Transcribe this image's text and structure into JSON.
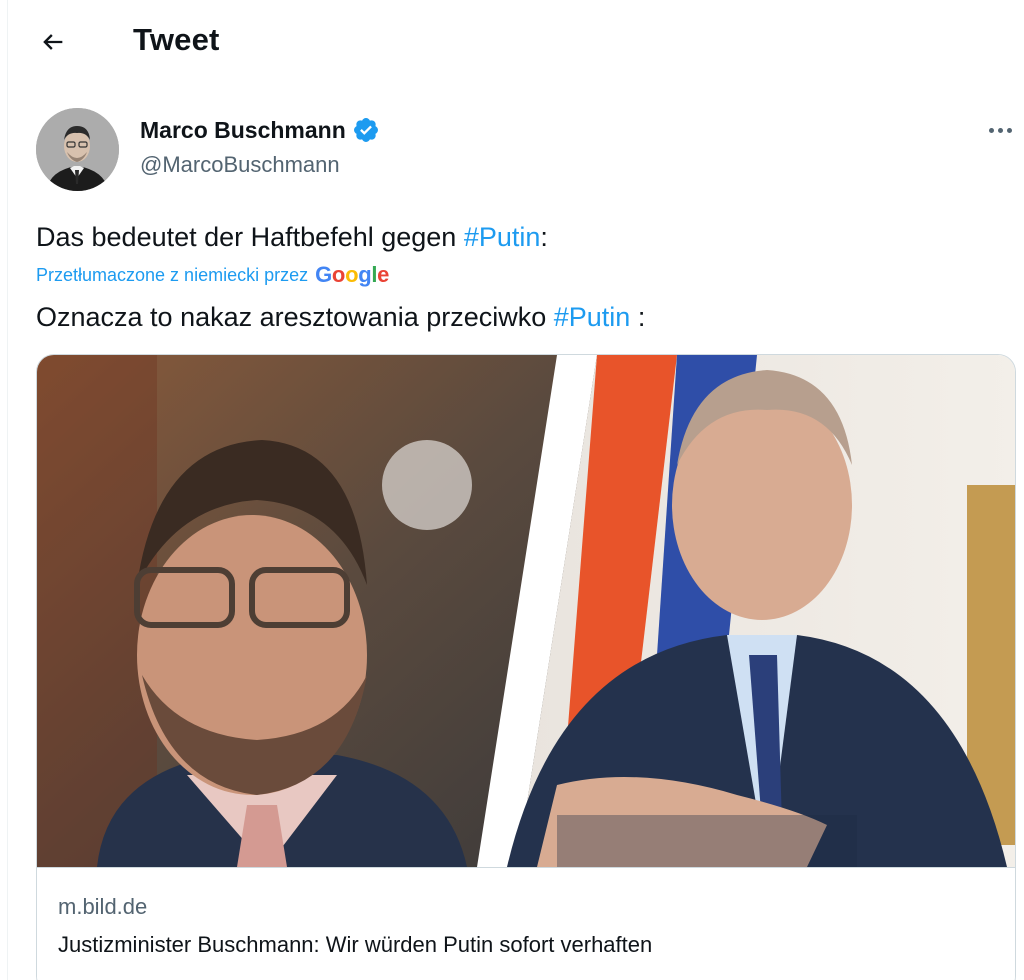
{
  "header": {
    "title": "Tweet"
  },
  "author": {
    "name": "Marco Buschmann",
    "handle": "@MarcoBuschmann",
    "verified": true
  },
  "tweet": {
    "text_before": "Das bedeutet der Haftbefehl gegen ",
    "hashtag": "#Putin",
    "text_after": ":"
  },
  "translation": {
    "label": "Przetłumaczone z niemiecki przez",
    "provider": "Google",
    "text_before": "Oznacza to nakaz aresztowania przeciwko ",
    "hashtag": "#Putin",
    "text_after": " :"
  },
  "card": {
    "domain": "m.bild.de",
    "title": "Justizminister Buschmann: Wir würden Putin sofort verhaften",
    "description": ""
  },
  "colors": {
    "accent": "#1d9bf0",
    "secondary_text": "#536471",
    "verified": "#1d9bf0"
  },
  "icons": {
    "back": "arrow-left-icon",
    "verified": "verified-badge-icon",
    "more": "more-horizontal-icon"
  }
}
